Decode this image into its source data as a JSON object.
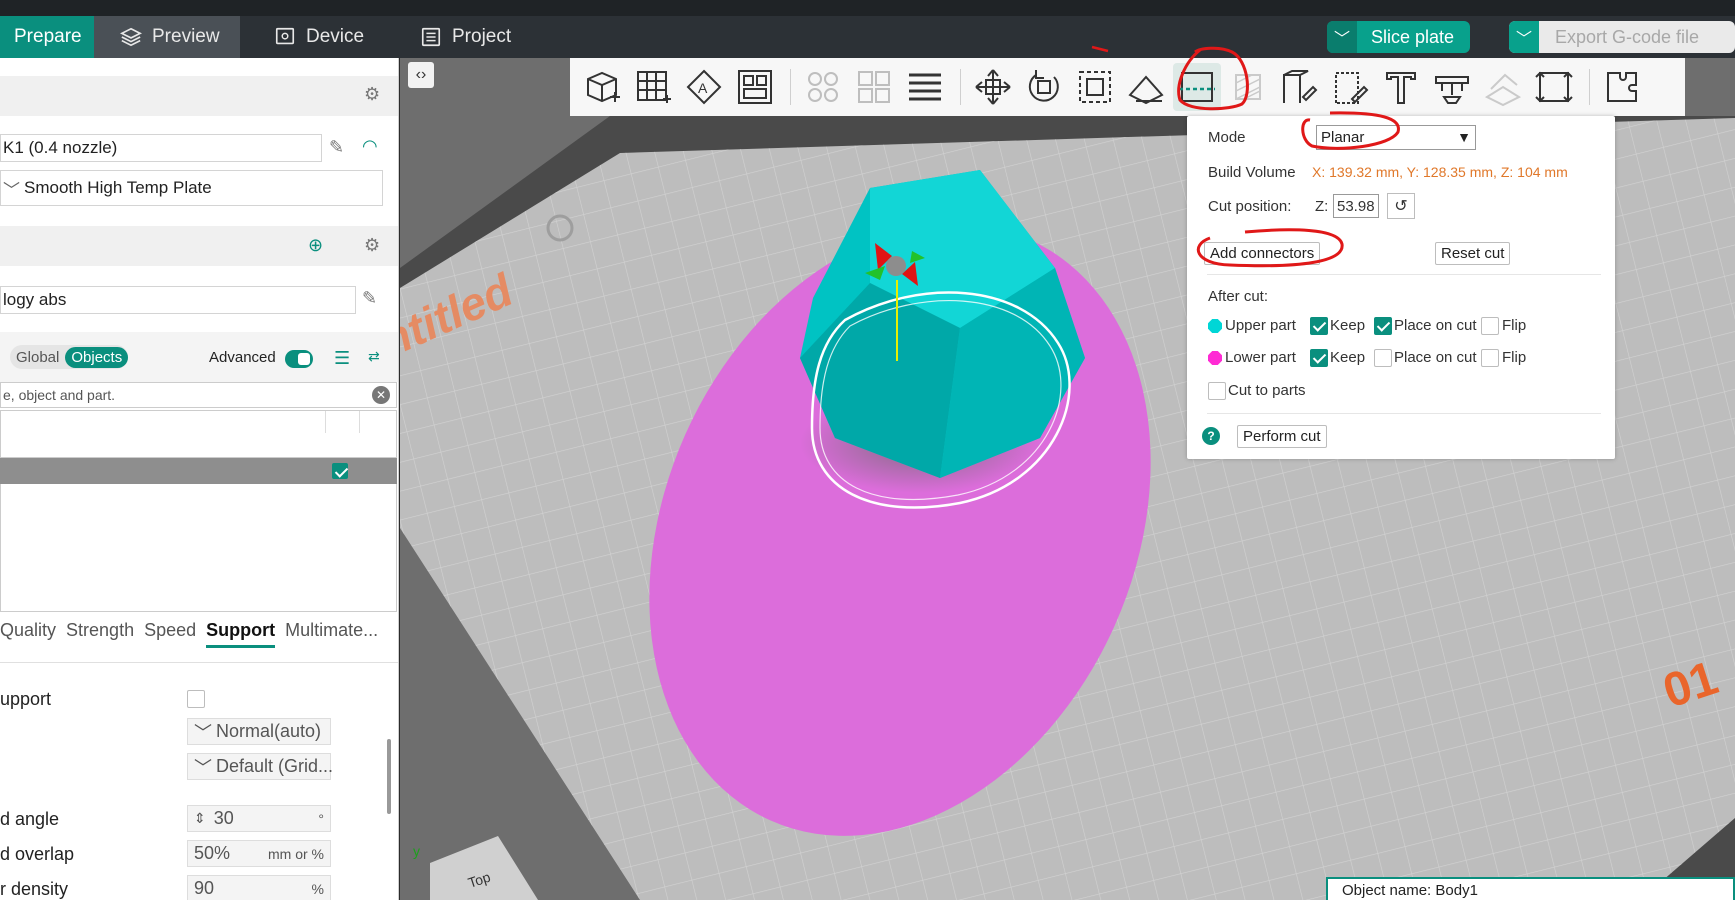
{
  "topbar": {
    "tabs": [
      {
        "label": "Prepare"
      },
      {
        "label": "Preview"
      },
      {
        "label": "Device"
      },
      {
        "label": "Project"
      }
    ],
    "slice_label": "Slice plate",
    "export_label": "Export G-code file"
  },
  "sidebar": {
    "printer": "K1 (0.4 nozzle)",
    "plate": "Smooth High Temp Plate",
    "filament": "logy abs",
    "scope_global": "Global",
    "scope_objects": "Objects",
    "advanced_label": "Advanced",
    "search_placeholder": "e, object and part.",
    "tabs": [
      "Quality",
      "Strength",
      "Speed",
      "Support",
      "Multimate..."
    ],
    "active_tab": "Support",
    "settings": [
      {
        "label": "upport",
        "value": ""
      },
      {
        "label": "",
        "value": "Normal(auto)"
      },
      {
        "label": "",
        "value": "Default (Grid..."
      },
      {
        "label": "d angle",
        "value": "30",
        "unit": "°"
      },
      {
        "label": "d overlap",
        "value": "50%",
        "unit": "mm or %"
      },
      {
        "label": "r density",
        "value": "90",
        "unit": "%"
      }
    ]
  },
  "viewport": {
    "plate_text": "ntitled",
    "plate_number": "01",
    "view_cube_label": "Top",
    "axis_label": "y"
  },
  "toolbar": {
    "icons": [
      "add-cube-icon",
      "arrange-grid-icon",
      "auto-orient-icon",
      "plate-layout-icon",
      "split-objects-icon",
      "split-parts-icon",
      "layers-icon",
      "move-icon",
      "rotate-icon",
      "scale-icon",
      "lay-on-face-icon",
      "cut-icon",
      "support-paint-icon",
      "seam-paint-icon",
      "color-paint-icon",
      "text-icon",
      "measure-icon",
      "assembly-icon",
      "boolean-icon",
      "fit-view-icon",
      "puzzle-icon"
    ],
    "active": "cut-icon"
  },
  "cut_panel": {
    "mode_label": "Mode",
    "mode_value": "Planar",
    "build_volume_label": "Build Volume",
    "build_volume_value": "X: 139.32 mm,  Y: 128.35 mm,  Z: 104 mm",
    "cut_position_label": "Cut position:",
    "axis": "Z:",
    "z_value": "53.98",
    "add_connectors": "Add connectors",
    "reset_cut": "Reset cut",
    "after_cut": "After cut:",
    "upper_part": "Upper part",
    "lower_part": "Lower part",
    "keep": "Keep",
    "place_on_cut": "Place on cut",
    "flip": "Flip",
    "cut_to_parts": "Cut to parts",
    "perform_cut": "Perform cut",
    "upper_color": "#00d6d6",
    "lower_color": "#ff2ad4",
    "upper_keep": true,
    "upper_place_on_cut": true,
    "upper_flip": false,
    "lower_keep": true,
    "lower_place_on_cut": false,
    "lower_flip": false,
    "cut_to_parts_checked": false
  },
  "object_name": "Object name: Body1",
  "colors": {
    "accent": "#0a8f7e",
    "model": "#00c8c8",
    "cut_plane": "#e26ee0",
    "annotation": "#e01818"
  }
}
